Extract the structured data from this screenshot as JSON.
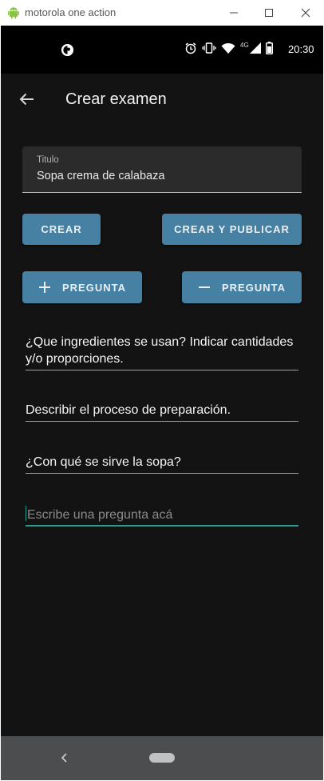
{
  "window": {
    "title": "motorola one action"
  },
  "status": {
    "time": "20:30",
    "network": "4G"
  },
  "appbar": {
    "title": "Crear examen"
  },
  "form": {
    "title_label": "Titulo",
    "title_value": "Sopa crema de calabaza"
  },
  "actions": {
    "crear": "CREAR",
    "crear_publicar": "CREAR Y PUBLICAR",
    "add_question": "PREGUNTA",
    "remove_question": "PREGUNTA"
  },
  "questions": [
    "¿Que ingredientes se usan? Indicar cantidades y/o proporciones.",
    "Describir el proceso de preparación.",
    "¿Con qué se sirve la sopa?"
  ],
  "new_question": {
    "placeholder": "Escribe una pregunta acá"
  },
  "colors": {
    "button": "#4680a3",
    "background": "#131313",
    "accent": "#2a9d8f"
  }
}
